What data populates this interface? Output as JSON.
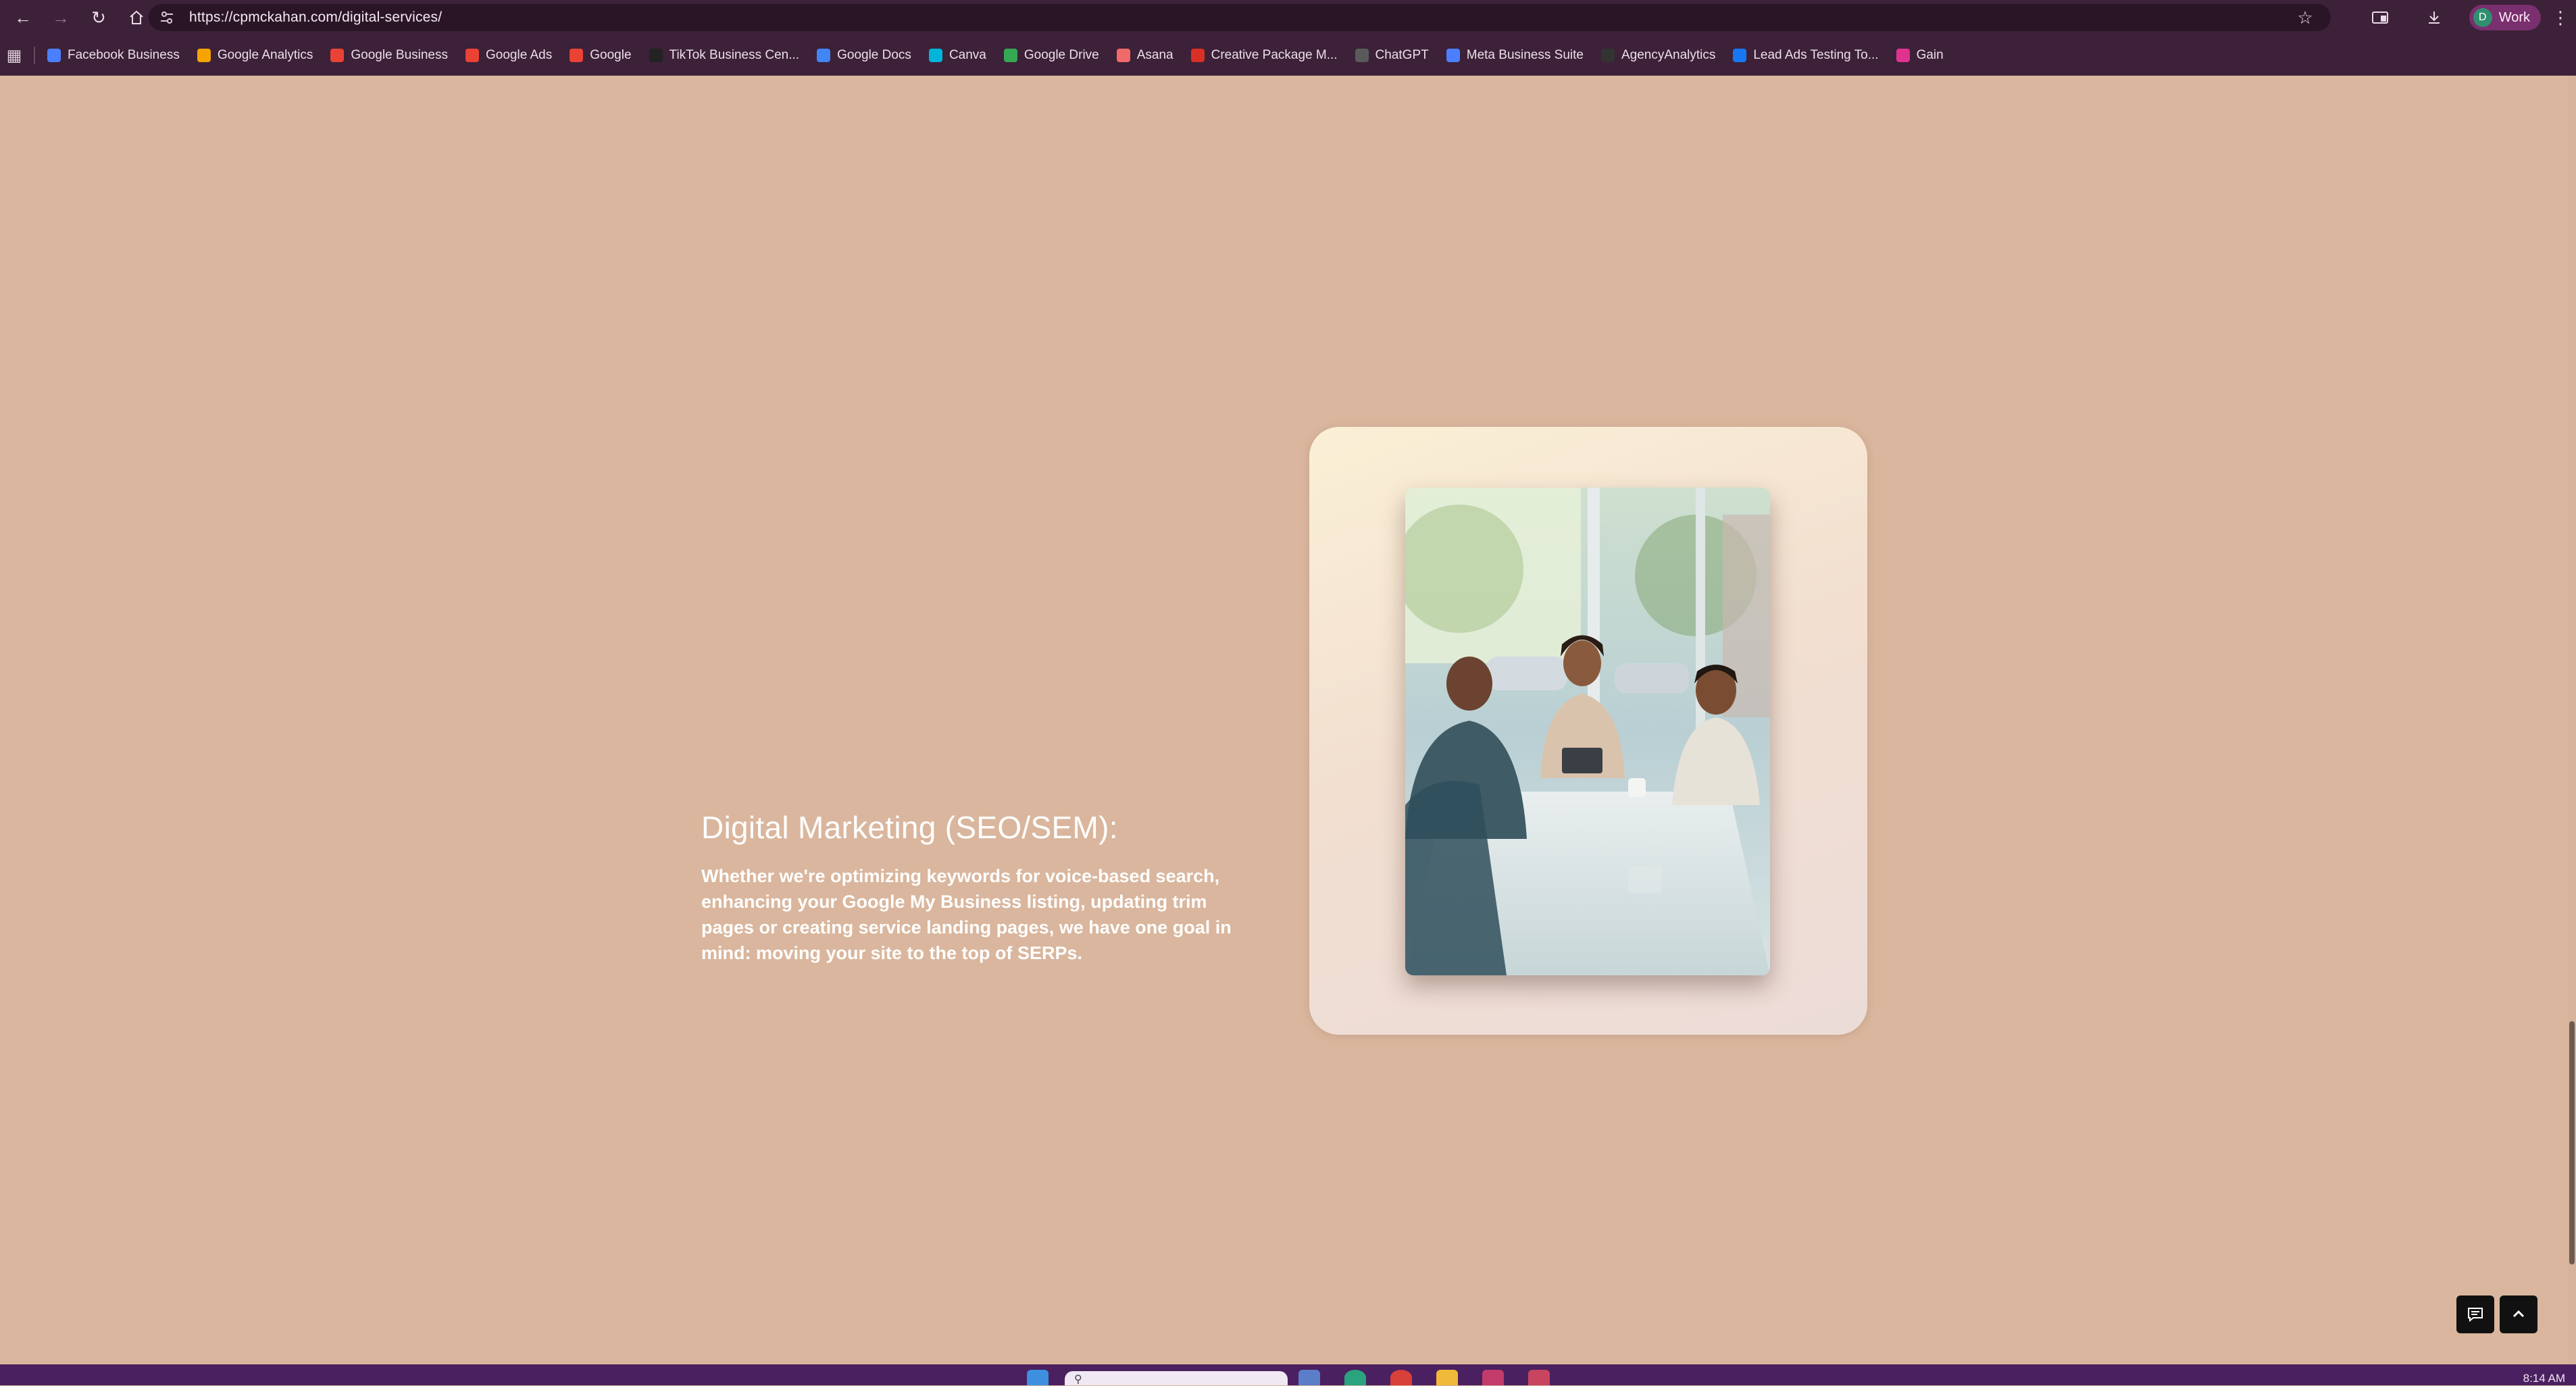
{
  "browser": {
    "url": "https://cpmckahan.com/digital-services/",
    "profile_label": "Work",
    "profile_initial": "D"
  },
  "bookmarks": [
    {
      "label": "Facebook Business",
      "icon": "meta-icon",
      "color": "#4b7fff"
    },
    {
      "label": "Google Analytics",
      "icon": "analytics-icon",
      "color": "#f4a300"
    },
    {
      "label": "Google Business",
      "icon": "google-icon",
      "color": "#ea4335"
    },
    {
      "label": "Google Ads",
      "icon": "google-icon",
      "color": "#ea4335"
    },
    {
      "label": "Google",
      "icon": "google-icon",
      "color": "#ea4335"
    },
    {
      "label": "TikTok Business Cen...",
      "icon": "tiktok-icon",
      "color": "#222222"
    },
    {
      "label": "Google Docs",
      "icon": "docs-icon",
      "color": "#4285f4"
    },
    {
      "label": "Canva",
      "icon": "canva-icon",
      "color": "#00b5d8"
    },
    {
      "label": "Google Drive",
      "icon": "drive-icon",
      "color": "#34a853"
    },
    {
      "label": "Asana",
      "icon": "asana-icon",
      "color": "#f06a6a"
    },
    {
      "label": "Creative Package M...",
      "icon": "gmail-icon",
      "color": "#d93025"
    },
    {
      "label": "ChatGPT",
      "icon": "chatgpt-icon",
      "color": "#5a5a5a"
    },
    {
      "label": "Meta Business Suite",
      "icon": "meta-icon",
      "color": "#4b7fff"
    },
    {
      "label": "AgencyAnalytics",
      "icon": "agency-analytics-icon",
      "color": "#333333"
    },
    {
      "label": "Lead Ads Testing To...",
      "icon": "facebook-icon",
      "color": "#1877f2"
    },
    {
      "label": "Gain",
      "icon": "gain-icon",
      "color": "#e0338f"
    }
  ],
  "content": {
    "heading": "Digital Marketing (SEO/SEM):",
    "description": "Whether we're optimizing keywords for voice-based search, enhancing your Google My Business listing, updating trim pages or creating service landing pages, we have one goal in mind: moving your site to the top of SERPs."
  },
  "taskbar": {
    "time": "8:14 AM"
  },
  "colors": {
    "page_background": "#d9b69d",
    "chrome": "#3c2138",
    "taskbar": "#4a2060"
  }
}
